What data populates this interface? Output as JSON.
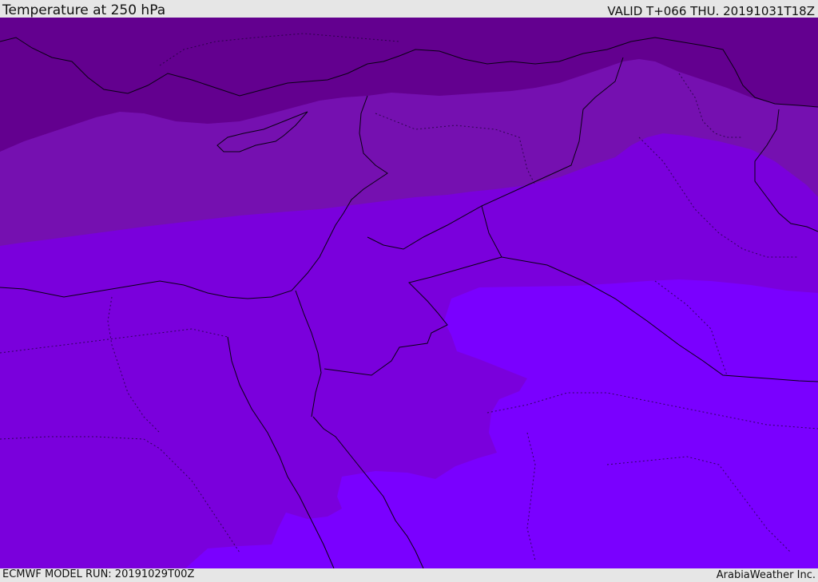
{
  "header": {
    "title": "Temperature at 250 hPa",
    "valid": "VALID T+066 THU. 20191031T18Z"
  },
  "footer": {
    "model_run": "ECMWF MODEL RUN: 20191029T00Z",
    "credit": "ArabiaWeather Inc."
  },
  "map": {
    "colors": {
      "band_1": "#63008f",
      "band_2": "#7510b0",
      "band_3": "#7a00dc",
      "band_4": "#7a00ff",
      "lines": "#0a0014"
    }
  }
}
